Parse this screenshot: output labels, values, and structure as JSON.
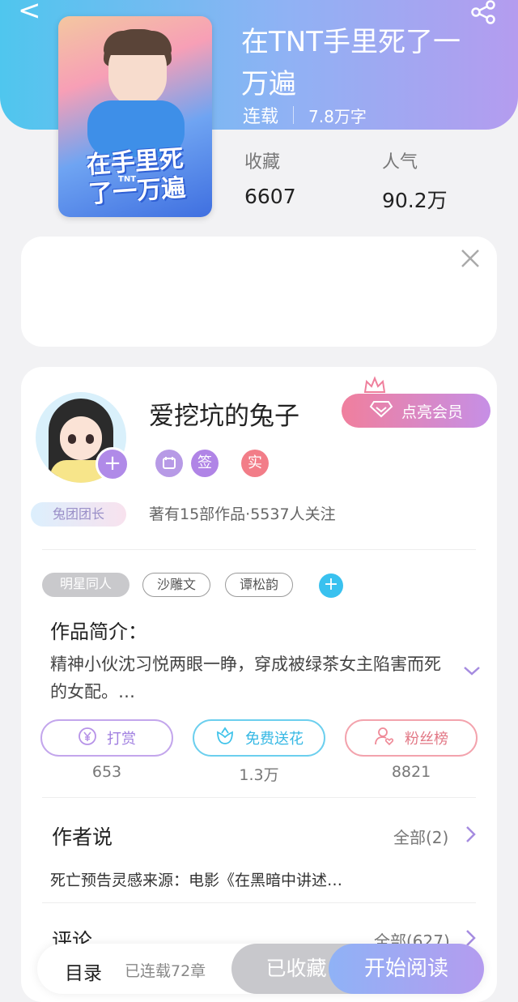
{
  "header": {
    "back_glyph": "<",
    "title": "在TNT手里死了一万遍",
    "status": "连载",
    "word_count": "7.8万字",
    "cover_title": "在手里死了一万遍",
    "cover_tnt": "TNT",
    "stats": [
      {
        "label": "收藏",
        "value": "6607"
      },
      {
        "label": "人气",
        "value": "90.2万"
      }
    ]
  },
  "author": {
    "name": "爱挖坑的兔子",
    "follow_glyph": "+",
    "vip_label": "点亮会员",
    "badges": [
      "",
      "签",
      "实"
    ],
    "rank_tag": "兔团团长",
    "summary": "著有15部作品·5537人关注"
  },
  "tags": [
    "明星同人",
    "沙雕文",
    "谭松韵"
  ],
  "tag_add_glyph": "+",
  "intro": {
    "label": "作品简介：",
    "text": "精神小伙沈习悦两眼一睁，穿成被绿茶女主陷害而死的女配。…"
  },
  "actions": [
    {
      "label": "打赏",
      "count": "653",
      "color": "#b38be6"
    },
    {
      "label": "免费送花",
      "count": "1.3万",
      "color": "#3fc3ea"
    },
    {
      "label": "粉丝榜",
      "count": "8821",
      "color": "#ef8a98"
    }
  ],
  "author_says": {
    "title": "作者说",
    "more": "全部(2)",
    "note": "死亡预告灵感来源：电影《在黑暗中讲述…"
  },
  "comments": {
    "title": "评论",
    "more": "全部(627)"
  },
  "bottom_bar": {
    "catalog": "目录",
    "chapters": "已连载72章",
    "collected": "已收藏",
    "start": "开始阅读"
  },
  "icons": {
    "back": "back-arrow-icon",
    "share": "share-icon",
    "close": "close-icon",
    "crown": "crown-icon",
    "diamond": "diamond-icon",
    "yen": "yen-coin-icon",
    "flower": "flower-icon",
    "fan": "person-heart-icon",
    "chevron": "chevron-right-icon",
    "expand": "chevron-down-icon"
  }
}
